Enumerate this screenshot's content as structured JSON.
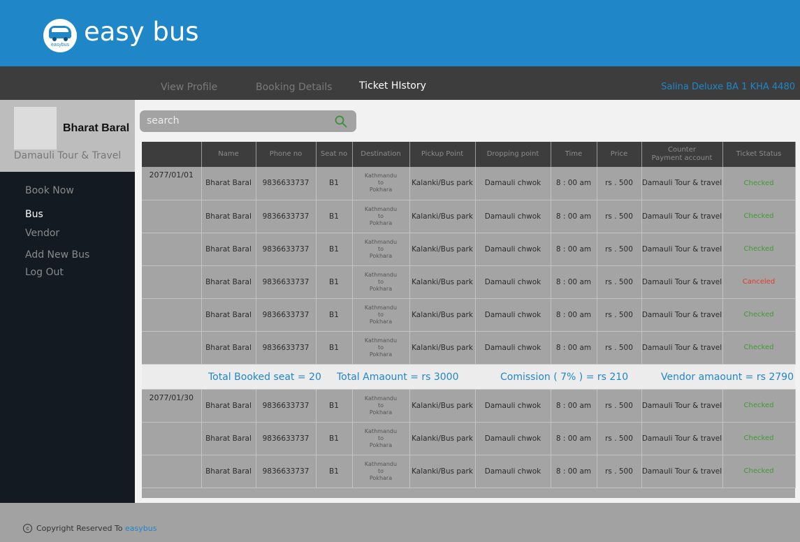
{
  "app": {
    "name": "easy bus",
    "logo_text": "easybus"
  },
  "nav": {
    "items": [
      {
        "label": "View Profile",
        "active": false
      },
      {
        "label": "Booking Details",
        "active": false
      },
      {
        "label": "Ticket HIstory",
        "active": true
      }
    ],
    "bus_name": "Salina Deluxe BA 1 KHA 4480"
  },
  "profile": {
    "name": "Bharat Baral",
    "company": "Damauli Tour & Travel"
  },
  "sidebar": {
    "items": [
      {
        "label": "Book Now",
        "active": false
      },
      {
        "label": "Bus",
        "active": true
      },
      {
        "label": "Vendor",
        "active": false
      },
      {
        "label": "Add New Bus",
        "active": false
      },
      {
        "label": "Log Out",
        "active": false
      }
    ]
  },
  "search": {
    "placeholder": "search"
  },
  "table": {
    "headers": [
      "",
      "Name",
      "Phone no",
      "Seat no",
      "Destination",
      "Pickup Point",
      "Dropping point",
      "Time",
      "Price",
      "Counter\nPayment account",
      "Ticket Status"
    ],
    "groups": [
      {
        "date": "2077/01/01",
        "rows": [
          {
            "name": "Bharat Baral",
            "phone": "9836633737",
            "seat": "B1",
            "dest_from": "Kathmandu",
            "dest_to": "to",
            "dest_end": "Pokhara",
            "pickup": "Kalanki/Bus park",
            "drop": "Damauli chwok",
            "time": "8 : 00 am",
            "price": "rs . 500",
            "account": "Damauli Tour & travel",
            "status": "Checked"
          },
          {
            "name": "Bharat Baral",
            "phone": "9836633737",
            "seat": "B1",
            "dest_from": "Kathmandu",
            "dest_to": "to",
            "dest_end": "Pokhara",
            "pickup": "Kalanki/Bus park",
            "drop": "Damauli chwok",
            "time": "8 : 00 am",
            "price": "rs . 500",
            "account": "Damauli Tour & travel",
            "status": "Checked"
          },
          {
            "name": "Bharat Baral",
            "phone": "9836633737",
            "seat": "B1",
            "dest_from": "Kathmandu",
            "dest_to": "to",
            "dest_end": "Pokhara",
            "pickup": "Kalanki/Bus park",
            "drop": "Damauli chwok",
            "time": "8 : 00 am",
            "price": "rs . 500",
            "account": "Damauli Tour & travel",
            "status": "Checked"
          },
          {
            "name": "Bharat Baral",
            "phone": "9836633737",
            "seat": "B1",
            "dest_from": "Kathmandu",
            "dest_to": "to",
            "dest_end": "Pokhara",
            "pickup": "Kalanki/Bus park",
            "drop": "Damauli chwok",
            "time": "8 : 00 am",
            "price": "rs . 500",
            "account": "Damauli Tour & travel",
            "status": "Canceled"
          },
          {
            "name": "Bharat Baral",
            "phone": "9836633737",
            "seat": "B1",
            "dest_from": "Kathmandu",
            "dest_to": "to",
            "dest_end": "Pokhara",
            "pickup": "Kalanki/Bus park",
            "drop": "Damauli chwok",
            "time": "8 : 00 am",
            "price": "rs . 500",
            "account": "Damauli Tour & travel",
            "status": "Checked"
          },
          {
            "name": "Bharat Baral",
            "phone": "9836633737",
            "seat": "B1",
            "dest_from": "Kathmandu",
            "dest_to": "to",
            "dest_end": "Pokhara",
            "pickup": "Kalanki/Bus park",
            "drop": "Damauli chwok",
            "time": "8 : 00 am",
            "price": "rs . 500",
            "account": "Damauli Tour & travel",
            "status": "Checked"
          }
        ],
        "summary": {
          "total_seat": "Total Booked seat = 20",
          "total_amount": "Total Amaount =  rs 3000",
          "commission": "Comission ( 7% ) =  rs 210",
          "vendor_amount": "Vendor amaount = rs 2790"
        }
      },
      {
        "date": "2077/01/30",
        "rows": [
          {
            "name": "Bharat Baral",
            "phone": "9836633737",
            "seat": "B1",
            "dest_from": "Kathmandu",
            "dest_to": "to",
            "dest_end": "Pokhara",
            "pickup": "Kalanki/Bus park",
            "drop": "Damauli chwok",
            "time": "8 : 00 am",
            "price": "rs . 500",
            "account": "Damauli Tour & travel",
            "status": "Checked"
          },
          {
            "name": "Bharat Baral",
            "phone": "9836633737",
            "seat": "B1",
            "dest_from": "Kathmandu",
            "dest_to": "to",
            "dest_end": "Pokhara",
            "pickup": "Kalanki/Bus park",
            "drop": "Damauli chwok",
            "time": "8 : 00 am",
            "price": "rs . 500",
            "account": "Damauli Tour & travel",
            "status": "Checked"
          },
          {
            "name": "Bharat Baral",
            "phone": "9836633737",
            "seat": "B1",
            "dest_from": "Kathmandu",
            "dest_to": "to",
            "dest_end": "Pokhara",
            "pickup": "Kalanki/Bus park",
            "drop": "Damauli chwok",
            "time": "8 : 00 am",
            "price": "rs . 500",
            "account": "Damauli Tour & travel",
            "status": "Checked"
          }
        ]
      }
    ]
  },
  "footer": {
    "text": "Copyright Reserved To",
    "brand": "easybus",
    "icon": "copyright-icon"
  },
  "colors": {
    "brand_blue": "#1f86c8",
    "status_checked": "#3f9a32",
    "status_canceled": "#e03a2a"
  }
}
